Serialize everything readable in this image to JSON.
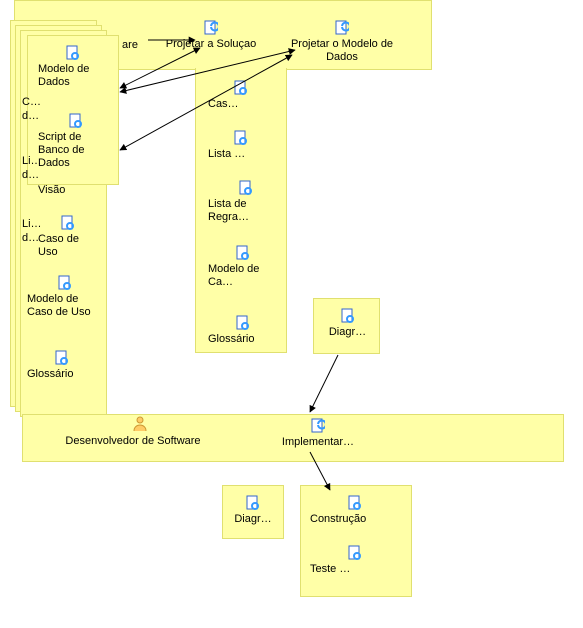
{
  "top_band": {
    "partial_role": "are",
    "task1": "Projetar a Soluçao",
    "task2": "Projetar o Modelo de Dados"
  },
  "left_stack": {
    "modelo_de_dados": "Modelo de Dados",
    "script_banco": "Script de Banco de Dados",
    "visao": "Visão",
    "caso_de_uso": "Caso de Uso",
    "modelo_caso_uso": "Modelo de Caso de Uso",
    "glossario": "Glossário",
    "frag_c": "C…",
    "frag_de": "d…",
    "frag_li1": "Li…",
    "frag_de2": "d…",
    "frag_li2": "Li…",
    "frag_de3": "d…"
  },
  "center_col": {
    "cas": "Cas…",
    "lista": "Lista …",
    "lista_regra": "Lista de Regra…",
    "modelo_ca": "Modelo de Ca…",
    "glossario": "Glossário"
  },
  "right_col": {
    "diagr": "Diagr…"
  },
  "row2": {
    "role": "Desenvolvedor de Software",
    "task": "Implementar…"
  },
  "bottom": {
    "diagr": "Diagr…",
    "construcao": "Construção",
    "teste": "Teste …"
  },
  "chart_data": {
    "type": "flow-diagram",
    "lanes": [
      {
        "role": "Arquiteto de Software",
        "tasks": [
          "Projetar a Soluçao",
          "Projetar o Modelo de Dados"
        ],
        "artifacts_task1": [
          "Cas…",
          "Lista …",
          "Lista de Regra…",
          "Modelo de Ca…",
          "Glossário"
        ],
        "artifacts_task2": [
          "Diagr…"
        ],
        "outputs": [
          "Modelo de Dados",
          "Script de Banco de Dados"
        ],
        "other_visible_artifacts": [
          "Visão",
          "Caso de Uso",
          "Modelo de Caso de Uso",
          "Glossário"
        ]
      },
      {
        "role": "Desenvolvedor de Software",
        "tasks": [
          "Implementar…"
        ],
        "inputs": [
          "Diagr…"
        ],
        "outputs": [
          "Construção",
          "Teste …"
        ]
      }
    ],
    "dependencies": [
      {
        "from": "Projetar a Soluçao",
        "to": "Modelo de Dados"
      },
      {
        "from": "Projetar o Modelo de Dados",
        "to": "Modelo de Dados"
      },
      {
        "from": "Projetar o Modelo de Dados",
        "to": "Script de Banco de Dados"
      },
      {
        "from": "Projetar o Modelo de Dados",
        "to": "Diagr…"
      },
      {
        "from": "Diagr…",
        "to": "Implementar…"
      },
      {
        "from": "Implementar…",
        "to": "Construção"
      }
    ]
  }
}
